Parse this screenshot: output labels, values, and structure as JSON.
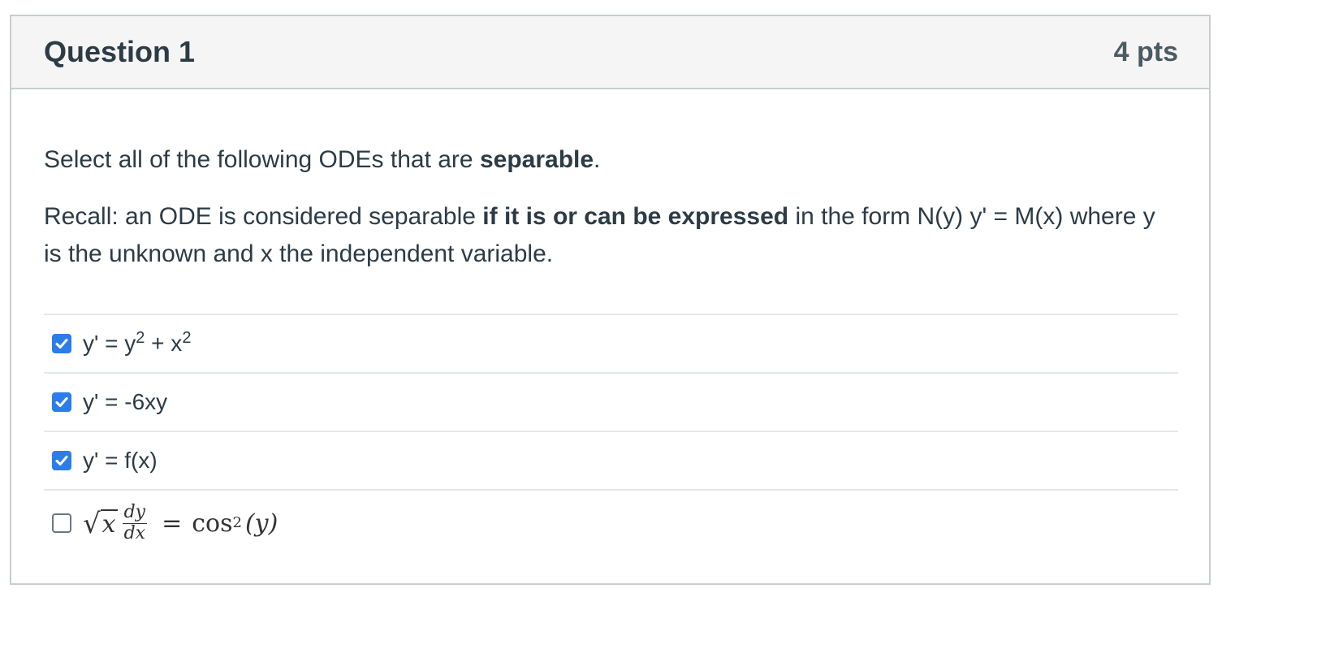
{
  "question": {
    "title": "Question 1",
    "points": "4 pts",
    "prompt_part1": "Select all of the following ODEs that are ",
    "prompt_bold1": "separable",
    "prompt_part2": ".",
    "recall_part1": "Recall: an ODE is considered separable ",
    "recall_bold": "if it is or can be expressed",
    "recall_part2": " in the form N(y) y' = M(x) where y is the unknown and x the independent variable."
  },
  "answers": [
    {
      "checked": true,
      "text_base": "y' = y",
      "sup1": "2",
      "mid": " + x",
      "sup2": "2"
    },
    {
      "checked": true,
      "text": "y' = -6xy"
    },
    {
      "checked": true,
      "text": "y' = f(x)"
    },
    {
      "checked": false,
      "math": {
        "sqrt_arg": "x",
        "frac_num": "dy",
        "frac_den": "dx",
        "eq": "=",
        "fn": "cos",
        "fn_exp": "2",
        "arg": "(y)"
      }
    }
  ],
  "colors": {
    "checkbox_checked": "#2b7de9",
    "header_bg": "#f5f5f5",
    "border": "#c7cdd1",
    "text": "#2d3b45"
  }
}
